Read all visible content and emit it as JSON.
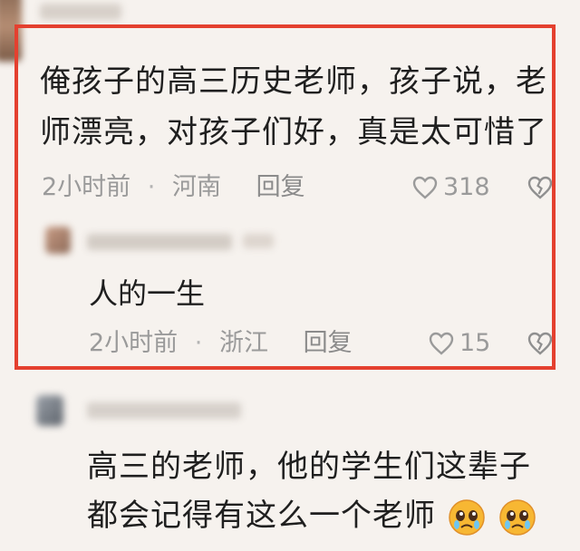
{
  "comment_1": {
    "text_lines": [
      "俺孩子的高三历史老师，孩子说，老",
      "师漂亮，对孩子们好，真是太可惜了"
    ],
    "time": "2小时前",
    "sep": "·",
    "location": "河南",
    "reply_label": "回复",
    "likes": "318"
  },
  "reply_1": {
    "text": "人的一生",
    "time": "2小时前",
    "sep": "·",
    "location": "浙江",
    "reply_label": "回复",
    "likes": "15"
  },
  "comment_2": {
    "text_lines": [
      "高三的老师，他的学生们这辈子",
      "都会记得有这么一个老师"
    ],
    "emoji_count": 2,
    "emoji_name": "crying-face-icon"
  },
  "colors": {
    "frame": "#e4402f",
    "background": "#f6f2ee",
    "meta": "#9a9a9a"
  }
}
